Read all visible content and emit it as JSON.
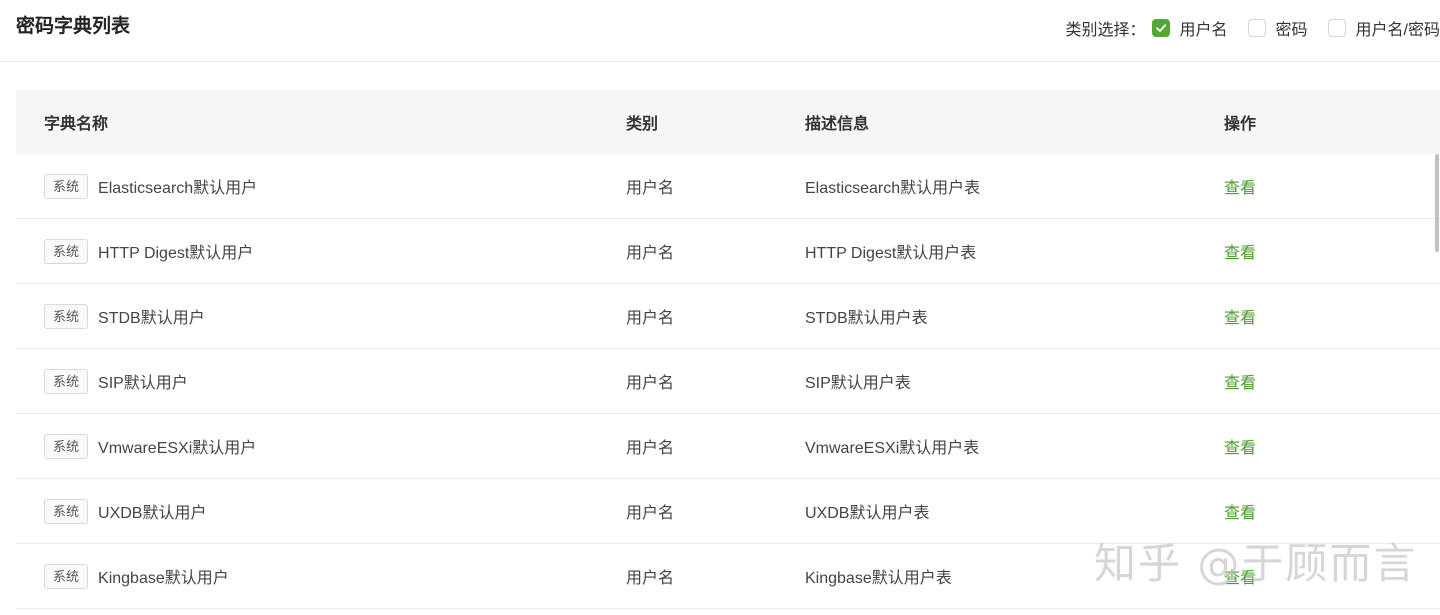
{
  "page": {
    "title": "密码字典列表"
  },
  "filter": {
    "label": "类别选择：",
    "options": [
      {
        "label": "用户名",
        "checked": true
      },
      {
        "label": "密码",
        "checked": false
      },
      {
        "label": "用户名/密码",
        "checked": false
      }
    ]
  },
  "table": {
    "headers": {
      "name": "字典名称",
      "category": "类别",
      "description": "描述信息",
      "action": "操作"
    },
    "rows": [
      {
        "tag": "系统",
        "name": "Elasticsearch默认用户",
        "category": "用户名",
        "description": "Elasticsearch默认用户表",
        "action": "查看"
      },
      {
        "tag": "系统",
        "name": "HTTP Digest默认用户",
        "category": "用户名",
        "description": "HTTP Digest默认用户表",
        "action": "查看"
      },
      {
        "tag": "系统",
        "name": "STDB默认用户",
        "category": "用户名",
        "description": "STDB默认用户表",
        "action": "查看"
      },
      {
        "tag": "系统",
        "name": "SIP默认用户",
        "category": "用户名",
        "description": "SIP默认用户表",
        "action": "查看"
      },
      {
        "tag": "系统",
        "name": "VmwareESXi默认用户",
        "category": "用户名",
        "description": "VmwareESXi默认用户表",
        "action": "查看"
      },
      {
        "tag": "系统",
        "name": "UXDB默认用户",
        "category": "用户名",
        "description": "UXDB默认用户表",
        "action": "查看"
      },
      {
        "tag": "系统",
        "name": "Kingbase默认用户",
        "category": "用户名",
        "description": "Kingbase默认用户表",
        "action": "查看"
      }
    ]
  },
  "watermark": {
    "text": "知乎 @于顾而言"
  },
  "colors": {
    "accent": "#52a832",
    "link": "#4a9d2b",
    "header_bg": "#f5f6f7"
  }
}
